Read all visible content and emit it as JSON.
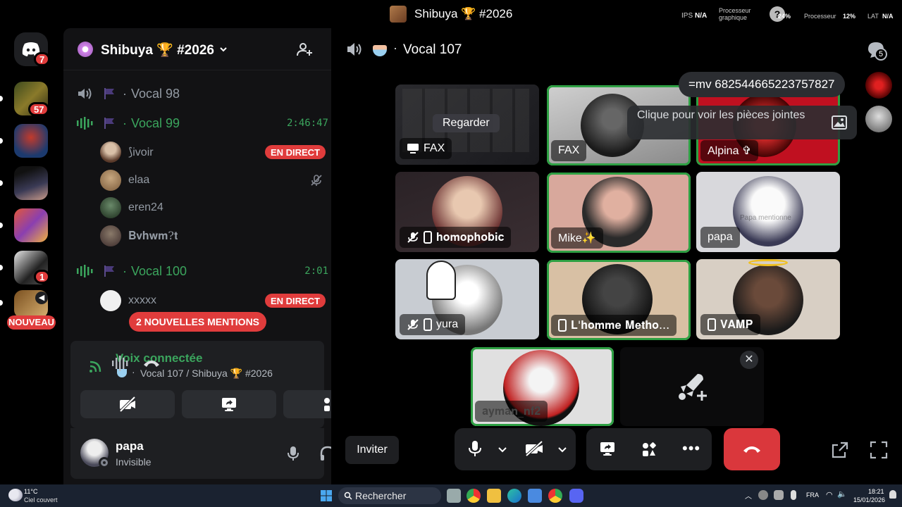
{
  "window": {
    "title": "Shibuya 🏆 #2026",
    "overlay": {
      "ips_label": "IPS",
      "ips_value": "N/A",
      "gpu_label": "Processeur graphique",
      "cpu_percent": "24%",
      "cpu_label": "Processeur",
      "cpu_value": "12%",
      "lat_label": "LAT",
      "lat_value": "N/A"
    }
  },
  "guilds": {
    "dm_badge": "7",
    "badges": [
      "57",
      "1"
    ],
    "new_label": "NOUVEAU"
  },
  "server": {
    "name": "Shibuya 🏆 #2026"
  },
  "channels": [
    {
      "name": "Vocal 98",
      "timer": ""
    },
    {
      "name": "Vocal 99",
      "timer": "2:46:47"
    },
    {
      "name": "Vocal 100",
      "timer": "2:01"
    }
  ],
  "members_99": [
    {
      "name": "⟆ivoir",
      "badge": "EN DIRECT"
    },
    {
      "name": "elaa",
      "badge": ""
    },
    {
      "name": "eren24",
      "badge": ""
    },
    {
      "name": "𝐁𝐯𝐡𝐰𝐦?𝐭",
      "badge": ""
    }
  ],
  "members_100": [
    {
      "name": "xxxxx",
      "badge": "EN DIRECT"
    }
  ],
  "mentions_label": "2 NOUVELLES MENTIONS",
  "voice": {
    "status": "Voix connectée",
    "location": "Vocal 107 / Shibuya 🏆 #2026"
  },
  "user": {
    "name": "papa",
    "status": "Invisible"
  },
  "stage": {
    "channel": "Vocal 107",
    "participants_count": "5",
    "chat_message": "=mv 682544665223757827",
    "attachment_hint": "Clique pour voir les pièces jointes",
    "watch_label": "Regarder",
    "invite_label": "Inviter",
    "tiles": [
      {
        "name": "FAX"
      },
      {
        "name": "FAX"
      },
      {
        "name": "Alpina ✞"
      },
      {
        "name": "𝐡𝐨𝐦𝐨𝐩𝐡𝐨𝐛𝐢𝐜"
      },
      {
        "name": "Mike✨"
      },
      {
        "name": "papa"
      },
      {
        "name": "yura"
      },
      {
        "name": "𝐋'𝐡𝐨𝐦𝐦𝐞 𝐌𝐞𝐭𝐡𝐨..."
      },
      {
        "name": "𝐕𝐀𝐌𝐏"
      },
      {
        "name": "𝐚𝐲𝐦𝐚𝐧_𝐧𝐟𝟐"
      }
    ],
    "papa_tile_watermark": "Papa mentionne"
  },
  "taskbar": {
    "weather_temp": "11°C",
    "weather_desc": "Ciel couvert",
    "search_placeholder": "Rechercher",
    "lang": "FRA",
    "time": "18:21",
    "date": "15/01/2026"
  },
  "colors": {
    "accent_green": "#2ea043",
    "danger": "#e03c3c",
    "voice_green": "#3ba55d"
  }
}
